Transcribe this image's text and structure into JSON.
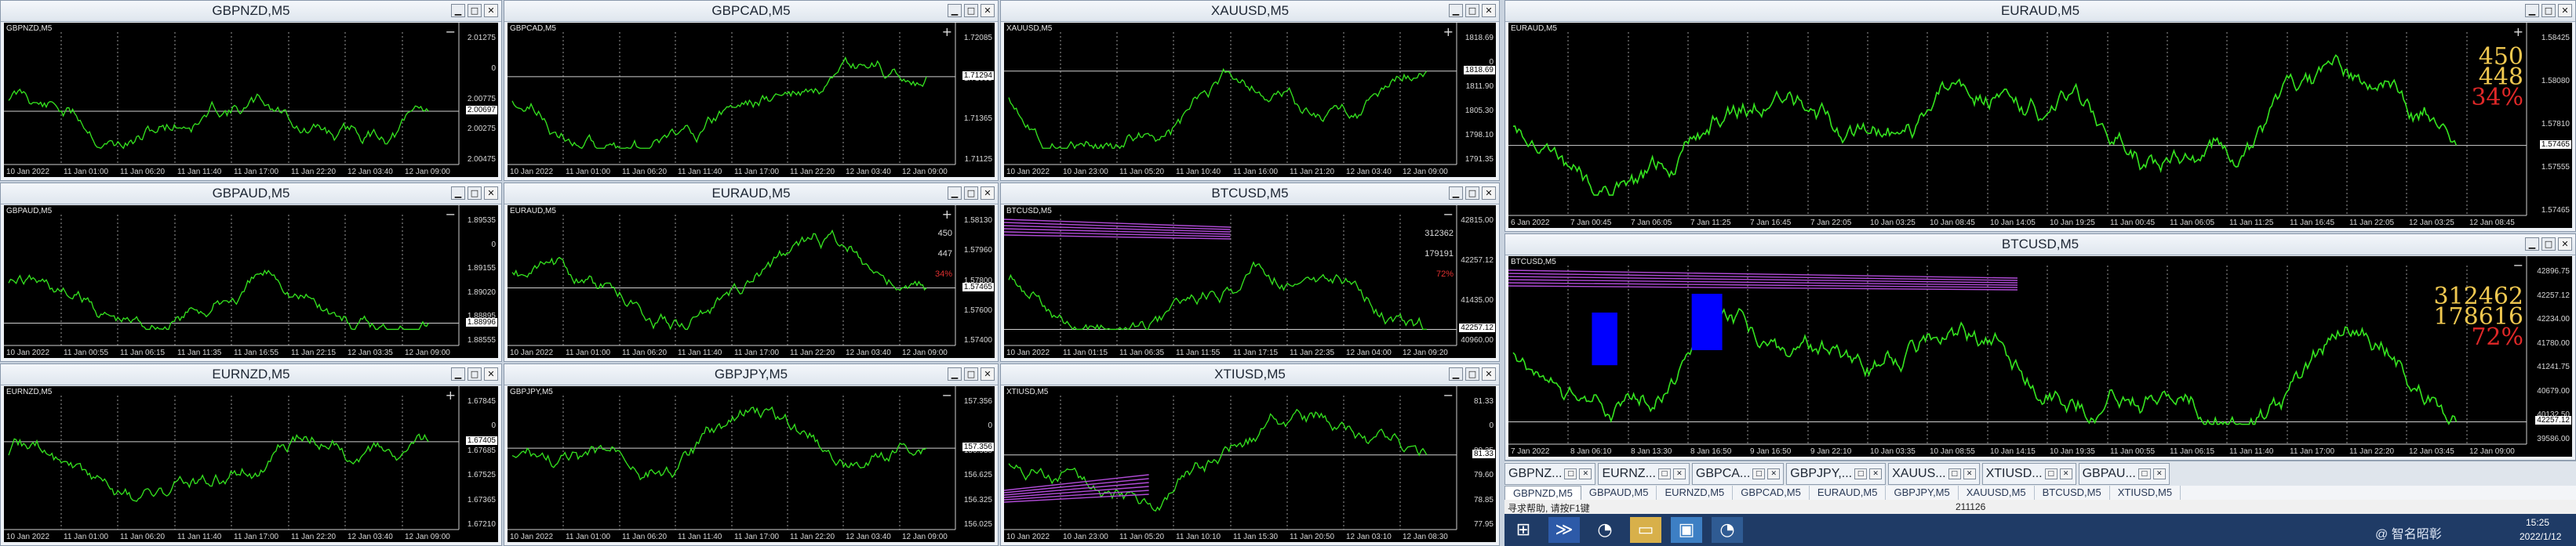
{
  "charts": [
    {
      "id": "gbpnzd",
      "title": "GBPNZD,M5",
      "symbol": "GBPNZD,M5",
      "color": "#35e51f",
      "seed": 11,
      "times": [
        "10 Jan 2022",
        "11 Jan 01:00",
        "11 Jan 06:20",
        "11 Jan 11:40",
        "11 Jan 17:00",
        "11 Jan 22:20",
        "12 Jan 03:40",
        "12 Jan 09:00"
      ],
      "prices": [
        "2.01275",
        "0",
        "2.00775",
        "2.00275",
        "2.00475"
      ],
      "price_tag": "2.00697",
      "plus": false
    },
    {
      "id": "gbpcad",
      "title": "GBPCAD,M5",
      "symbol": "GBPCAD,M5",
      "color": "#35e51f",
      "seed": 23,
      "times": [
        "10 Jan 2022",
        "11 Jan 01:00",
        "11 Jan 06:20",
        "11 Jan 11:40",
        "11 Jan 17:00",
        "11 Jan 22:20",
        "12 Jan 03:40",
        "12 Jan 09:00"
      ],
      "prices": [
        "1.72085",
        "1.71605",
        "1.71365",
        "1.71125"
      ],
      "price_tag": "1.71294",
      "plus": true
    },
    {
      "id": "xauusd",
      "title": "XAUUSD,M5",
      "symbol": "XAUUSD,M5",
      "color": "#35e51f",
      "seed": 37,
      "times": [
        "10 Jan 2022",
        "10 Jan 23:00",
        "11 Jan 05:20",
        "11 Jan 10:40",
        "11 Jan 16:00",
        "11 Jan 21:20",
        "12 Jan 03:40",
        "12 Jan 09:00"
      ],
      "prices": [
        "1818.69",
        "0",
        "1811.90",
        "1805.30",
        "1798.10",
        "1791.35"
      ],
      "price_tag": "1818.69",
      "plus": true
    },
    {
      "id": "gbpaud",
      "title": "GBPAUD,M5",
      "symbol": "GBPAUD,M5",
      "color": "#35e51f",
      "seed": 41,
      "times": [
        "10 Jan 2022",
        "11 Jan 00:55",
        "11 Jan 06:15",
        "11 Jan 11:35",
        "11 Jan 16:55",
        "11 Jan 22:15",
        "12 Jan 03:35",
        "12 Jan 09:00"
      ],
      "prices": [
        "1.89535",
        "0",
        "1.89155",
        "1.89020",
        "1.88895",
        "1.88555"
      ],
      "price_tag": "1.88996",
      "plus": false
    },
    {
      "id": "euraud",
      "title": "EURAUD,M5",
      "symbol": "EURAUD,M5",
      "color": "#35e51f",
      "seed": 53,
      "times": [
        "10 Jan 2022",
        "11 Jan 01:00",
        "11 Jan 06:20",
        "11 Jan 11:40",
        "11 Jan 17:00",
        "11 Jan 22:20",
        "12 Jan 03:40",
        "12 Jan 09:00"
      ],
      "prices": [
        "1.58130",
        "1.57960",
        "1.57800",
        "1.57600",
        "1.57400"
      ],
      "price_tag": "1.57465",
      "plus": true,
      "ind": [
        "450",
        "447",
        "34%"
      ]
    },
    {
      "id": "btcusd",
      "title": "BTCUSD,M5",
      "symbol": "BTCUSD,M5",
      "color": "#35e51f",
      "seed": 61,
      "times": [
        "10 Jan 2022",
        "11 Jan 01:15",
        "11 Jan 06:35",
        "11 Jan 11:55",
        "11 Jan 17:15",
        "11 Jan 22:35",
        "12 Jan 04:00",
        "12 Jan 09:20"
      ],
      "prices": [
        "42815.00",
        "42257.12",
        "41435.00",
        "40960.00"
      ],
      "price_tag": "42257.12",
      "plus": false,
      "ind": [
        "312362",
        "179191",
        "72%"
      ]
    },
    {
      "id": "eurnzd",
      "title": "EURNZD,M5",
      "symbol": "EURNZD,M5",
      "color": "#35e51f",
      "seed": 71,
      "times": [
        "10 Jan 2022",
        "11 Jan 01:00",
        "11 Jan 06:20",
        "11 Jan 11:40",
        "11 Jan 17:00",
        "11 Jan 22:20",
        "12 Jan 03:40",
        "12 Jan 09:00"
      ],
      "prices": [
        "1.67845",
        "0",
        "1.67685",
        "1.67525",
        "1.67365",
        "1.67210"
      ],
      "price_tag": "1.67405",
      "plus": true
    },
    {
      "id": "gbpjpy",
      "title": "GBPJPY,M5",
      "symbol": "GBPJPY,M5",
      "color": "#35e51f",
      "seed": 83,
      "times": [
        "10 Jan 2022",
        "11 Jan 01:00",
        "11 Jan 06:20",
        "11 Jan 11:40",
        "11 Jan 17:00",
        "11 Jan 22:20",
        "12 Jan 03:40",
        "12 Jan 09:00"
      ],
      "prices": [
        "157.356",
        "0",
        "156.930",
        "156.625",
        "156.325",
        "156.025"
      ],
      "price_tag": "157.356",
      "plus": false
    },
    {
      "id": "xtiusd",
      "title": "XTIUSD,M5",
      "symbol": "XTIUSD,M5",
      "color": "#35e51f",
      "seed": 97,
      "times": [
        "10 Jan 2022",
        "10 Jan 23:00",
        "11 Jan 05:20",
        "11 Jan 10:10",
        "11 Jan 15:30",
        "11 Jan 20:50",
        "12 Jan 03:10",
        "12 Jan 08:30"
      ],
      "prices": [
        "81.33",
        "0",
        "80.35",
        "79.60",
        "78.85",
        "77.95"
      ],
      "price_tag": "81.33",
      "plus": false
    },
    {
      "id": "euraud_big",
      "title": "EURAUD,M5",
      "symbol": "EURAUD,M5",
      "color": "#35e51f",
      "seed": 103,
      "times": [
        "6 Jan 2022",
        "7 Jan 00:45",
        "7 Jan 06:05",
        "7 Jan 11:25",
        "7 Jan 16:45",
        "7 Jan 22:05",
        "10 Jan 03:25",
        "10 Jan 08:45",
        "10 Jan 14:05",
        "10 Jan 19:25",
        "11 Jan 00:45",
        "11 Jan 06:05",
        "11 Jan 11:25",
        "11 Jan 16:45",
        "11 Jan 22:05",
        "12 Jan 03:25",
        "12 Jan 08:45"
      ],
      "prices": [
        "1.58425",
        "1.58080",
        "1.57810",
        "1.57555",
        "1.57465"
      ],
      "price_tag": "1.57465",
      "plus": true,
      "big": [
        "450",
        "448",
        "34%"
      ]
    },
    {
      "id": "btcusd_big",
      "title": "BTCUSD,M5",
      "symbol": "BTCUSD,M5",
      "color": "#35e51f",
      "seed": 117,
      "times": [
        "7 Jan 2022",
        "8 Jan 06:10",
        "8 Jan 13:30",
        "8 Jan 16:50",
        "9 Jan 16:50",
        "9 Jan 22:10",
        "10 Jan 03:35",
        "10 Jan 08:55",
        "10 Jan 14:15",
        "10 Jan 19:35",
        "11 Jan 00:55",
        "11 Jan 06:15",
        "11 Jan 11:40",
        "11 Jan 17:00",
        "11 Jan 22:20",
        "12 Jan 03:45",
        "12 Jan 09:00"
      ],
      "prices": [
        "42896.75",
        "42257.12",
        "42234.00",
        "41780.00",
        "41241.75",
        "40679.00",
        "40132.50",
        "39586.00"
      ],
      "price_tag": "42257.12",
      "plus": false,
      "big": [
        "312462",
        "178616",
        "72%"
      ]
    }
  ],
  "tabs": [
    "GBPNZ...",
    "EURNZ...",
    "GBPCA...",
    "GBPJPY,...",
    "XAUUS...",
    "XTIUSD...",
    "GBPAU..."
  ],
  "subtabs": [
    "GBPNZD,M5",
    "GBPAUD,M5",
    "EURNZD,M5",
    "GBPCAD,M5",
    "EURAUD,M5",
    "GBPJPY,M5",
    "XAUUSD,M5",
    "BTCUSD,M5",
    "XTIUSD,M5"
  ],
  "status": {
    "help": "寻求帮助, 请按F1键",
    "bytes": "211126"
  },
  "tray": {
    "time": "15:25",
    "date": "2022/1/12",
    "watermark": "@ 智名昭彰"
  },
  "colors": {
    "bg": "#000000",
    "candle": "#35e51f",
    "grid": "#8a8a8a",
    "rect": "#0000ff",
    "trend": "#b04bd6"
  }
}
